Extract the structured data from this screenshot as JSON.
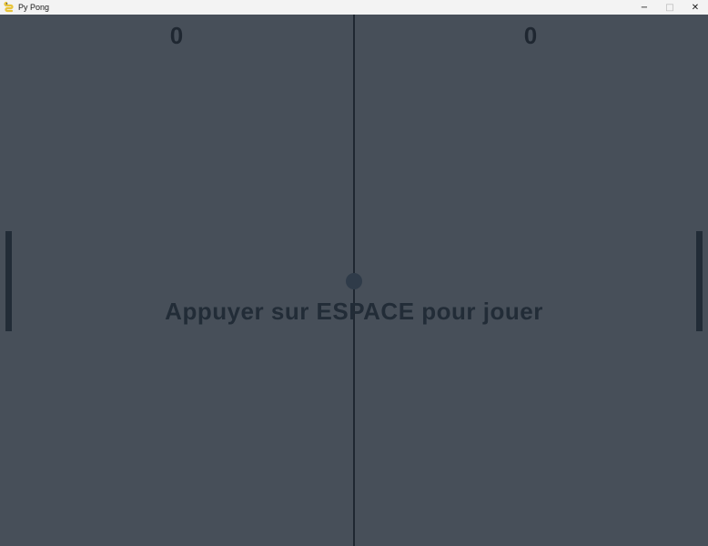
{
  "window": {
    "title": "Py Pong",
    "app_icon": "pygame-snake-icon",
    "controls": {
      "minimize": "−",
      "maximize": "□",
      "close": "✕"
    }
  },
  "game": {
    "score_left": "0",
    "score_right": "0",
    "prompt": "Appuyer sur ESPACE pour jouer"
  },
  "colors": {
    "background": "#474f59",
    "foreground": "#1f2731",
    "titlebar": "#f3f3f3"
  }
}
